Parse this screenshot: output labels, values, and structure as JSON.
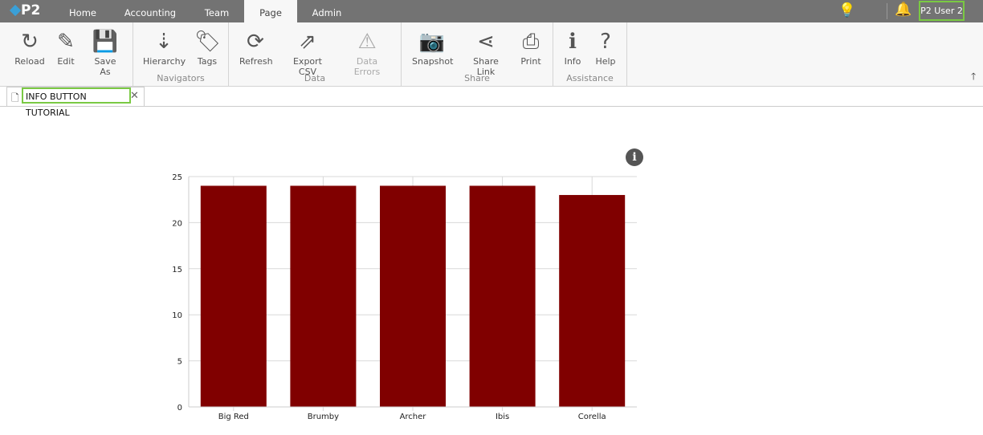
{
  "app": {
    "logo": "P2",
    "tabs": [
      "Home",
      "Accounting",
      "Team",
      "Page",
      "Admin"
    ],
    "active_tab": "Page",
    "user": "P2 User 2"
  },
  "ribbon": {
    "buttons": [
      {
        "label": "Reload",
        "icon": "↻"
      },
      {
        "label": "Edit",
        "icon": "✎"
      },
      {
        "label": "Save As",
        "icon": "💾"
      },
      {
        "label": "Hierarchy",
        "icon": "⇣"
      },
      {
        "label": "Tags",
        "icon": "🏷"
      },
      {
        "label": "Refresh",
        "icon": "⟳"
      },
      {
        "label": "Export CSV",
        "icon": "⇗"
      },
      {
        "label": "Data Errors",
        "icon": "⚠"
      },
      {
        "label": "Snapshot",
        "icon": "📷"
      },
      {
        "label": "Share Link",
        "icon": "⋖"
      },
      {
        "label": "Print",
        "icon": "⎙"
      },
      {
        "label": "Info",
        "icon": "ℹ"
      },
      {
        "label": "Help",
        "icon": "?"
      }
    ],
    "groups": [
      "Navigators",
      "Data",
      "Share",
      "Assistance"
    ]
  },
  "doc_tab": {
    "title": "INFO BUTTON TUTORIAL"
  },
  "chart_data": {
    "type": "bar",
    "categories": [
      "Big Red",
      "Brumby",
      "Archer",
      "Ibis",
      "Corella"
    ],
    "values": [
      24,
      24,
      24,
      24,
      23
    ],
    "ylim": [
      0,
      25
    ],
    "yticks": [
      0,
      5,
      10,
      15,
      20,
      25
    ],
    "title": "",
    "xlabel": "",
    "ylabel": "",
    "color": "#800000",
    "grid": true
  }
}
